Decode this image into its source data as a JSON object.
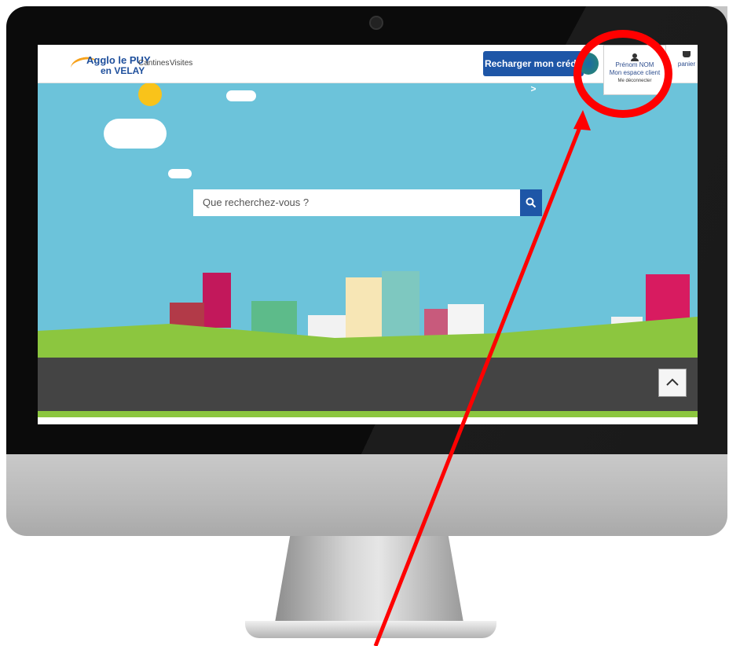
{
  "screen": {
    "nav": {
      "link1": "Cantines",
      "link2": "Visites"
    },
    "logo": {
      "line1": "Agglo le PUY",
      "line2": "en VELAY"
    },
    "recharge_label": "Recharger mon crédit >",
    "account": {
      "name": "Prénom NOM",
      "space": "Mon espace client",
      "logout": "Me déconnecter"
    },
    "basket_label": "panier",
    "search": {
      "placeholder": "Que recherchez-vous ?"
    }
  },
  "colors": {
    "brand_blue": "#1e56a7",
    "sky": "#6cc3da",
    "annotation_red": "#ff0000"
  }
}
